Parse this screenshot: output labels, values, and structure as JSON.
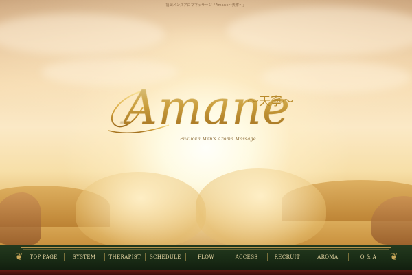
{
  "header": {
    "tagline": "福岡メンズアロママッサージ「Amane〜天寧〜」"
  },
  "logo": {
    "word": "Amane",
    "kanji": "〜天寧〜",
    "subtitle": "Fukuoka Men's Aroma Massage"
  },
  "nav": {
    "items": [
      {
        "label": "TOP PAGE"
      },
      {
        "label": "SYSTEM"
      },
      {
        "label": "THERAPIST"
      },
      {
        "label": "SCHEDULE"
      },
      {
        "label": "FLOW"
      },
      {
        "label": "ACCESS"
      },
      {
        "label": "RECRUIT"
      },
      {
        "label": "AROMA"
      },
      {
        "label": "Q & A"
      }
    ]
  },
  "colors": {
    "gold": "#c9962e",
    "nav_bg": "#1a2d16",
    "nav_text": "#e9d9a6",
    "bottom_bar": "#5a1511"
  }
}
